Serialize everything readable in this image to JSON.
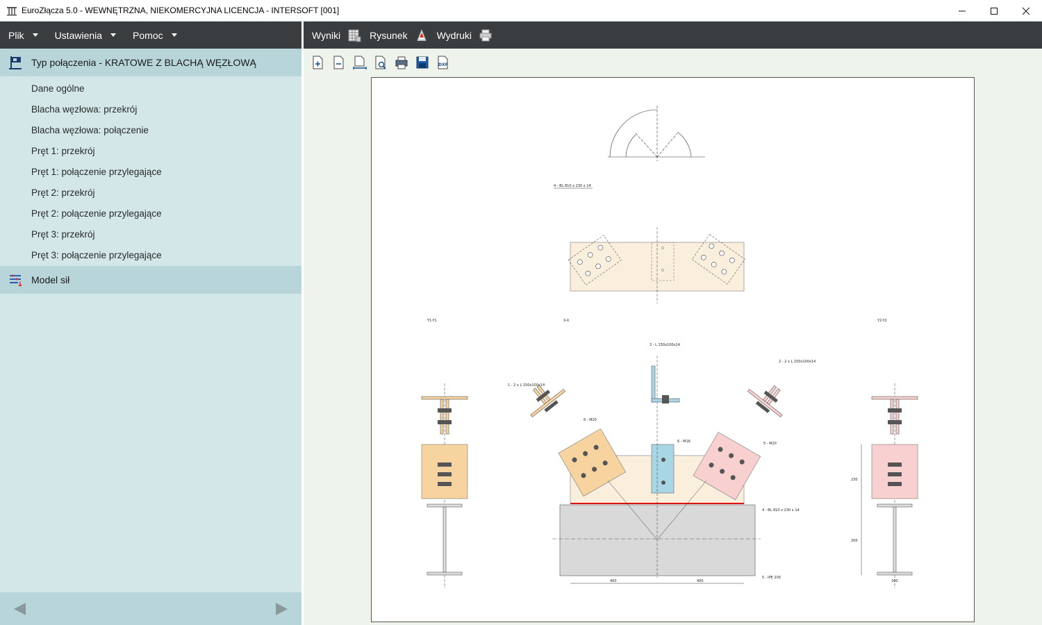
{
  "window": {
    "title": "EuroZłącza 5.0 - WEWNĘTRZNA, NIEKOMERCYJNA LICENCJA - INTERSOFT [001]",
    "controls": [
      "minimize",
      "maximize",
      "close"
    ]
  },
  "menu": {
    "items": [
      {
        "label": "Plik"
      },
      {
        "label": "Ustawienia"
      },
      {
        "label": "Pomoc"
      }
    ]
  },
  "sidebar": {
    "section_title": "Typ połączenia - KRATOWE Z BLACHĄ WĘZŁOWĄ",
    "items": [
      {
        "label": "Dane ogólne"
      },
      {
        "label": "Blacha węzłowa: przekrój"
      },
      {
        "label": "Blacha węzłowa: połączenie"
      },
      {
        "label": "Pręt 1: przekrój"
      },
      {
        "label": "Pręt 1: połączenie przylegające"
      },
      {
        "label": "Pręt 2: przekrój"
      },
      {
        "label": "Pręt 2: połączenie przylegające"
      },
      {
        "label": "Pręt 3: przekrój"
      },
      {
        "label": "Pręt 3: połączenie przylegające"
      }
    ],
    "model_section": "Model sił"
  },
  "top_tabs": [
    {
      "label": "Wyniki",
      "icon": "table-icon"
    },
    {
      "label": "Rysunek",
      "icon": "drawing-icon"
    },
    {
      "label": "Wydruki",
      "icon": "printer-icon"
    }
  ],
  "toolbar": {
    "buttons": [
      "zoom-in-icon",
      "zoom-out-icon",
      "fit-width-icon",
      "preview-icon",
      "print-icon",
      "save-icon",
      "dxf-export-icon"
    ],
    "dxf_text": "DXF"
  },
  "drawing": {
    "plate_label": "4 - BL 810 x 230 x 14",
    "view_y1": "Y1-Y1",
    "view_x": "X-X",
    "view_y2": "Y2-Y2",
    "member1": "1 - 2 x L 150x100x14",
    "member2": "2 - 2 x L 150x100x14",
    "member3": "3 - L 150x100x14",
    "bolts_m20_a": "6 - M20",
    "bolts_m20_b": "5 - M20",
    "bolts_m16": "6 - M16",
    "plate_label2": "4 - BL 810 x 230 x 14",
    "beam": "5 - IPE 200",
    "dim_400a": "400",
    "dim_400b": "400",
    "dim_100": "100",
    "dim_230": "230",
    "dim_200": "200"
  },
  "colors": {
    "menubar": "#3a3d3f",
    "sidebar_bg": "#d3e6e8",
    "sidebar_section": "#b8d6d9",
    "plate_fill": "#f9efdc",
    "member1_fill": "#f7d3a0",
    "member2_fill": "#f8d0d0",
    "member3_fill": "#a9d6e5",
    "beam_fill": "#d9d9d9",
    "weld": "#e01010"
  }
}
